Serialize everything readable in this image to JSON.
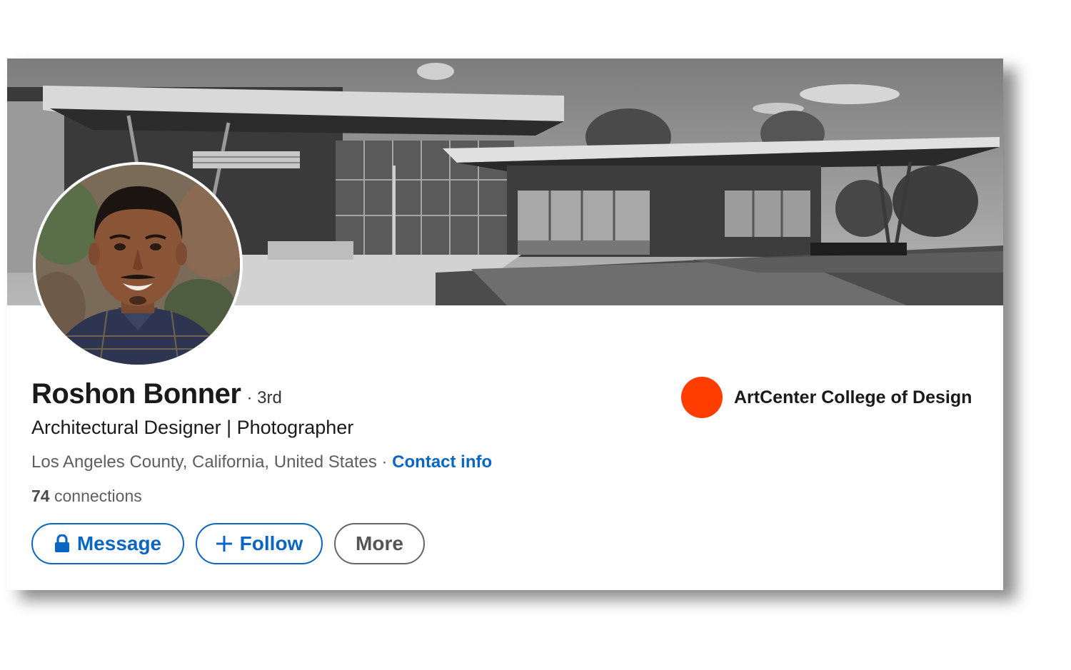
{
  "profile": {
    "name": "Roshon Bonner",
    "degree": "· 3rd",
    "headline": "Architectural Designer | Photographer",
    "location": "Los Angeles County, California, United States",
    "separator": " · ",
    "contact_label": "Contact info",
    "connections_count": "74",
    "connections_label": " connections"
  },
  "actions": {
    "message_label": "Message",
    "follow_label": "Follow",
    "more_label": "More"
  },
  "education": {
    "school_name": "ArtCenter College of Design",
    "logo_color": "#ff3d00"
  },
  "icons": {
    "message": "lock-icon",
    "follow": "plus-icon"
  },
  "colors": {
    "accent": "#0a66c2",
    "text_primary": "#1a1a1a",
    "text_secondary": "#5e5e5e"
  }
}
